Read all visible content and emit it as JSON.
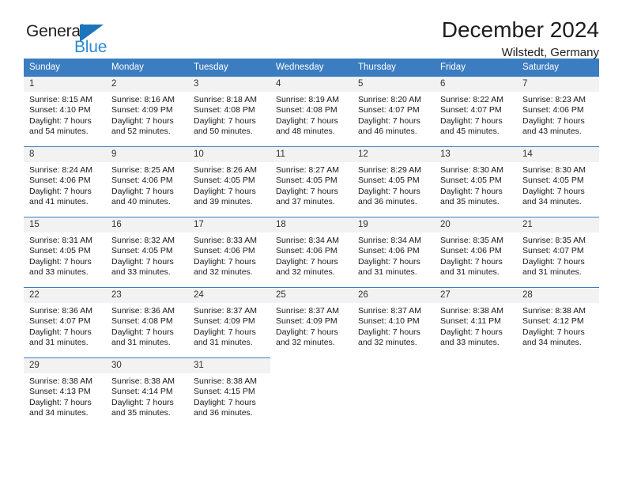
{
  "brand": {
    "name_part1": "General",
    "name_part2": "Blue",
    "triangle_icon": "triangle-icon",
    "accent_color": "#1b75bb",
    "secondary_color": "#2e8bd0"
  },
  "header": {
    "title": "December 2024",
    "subtitle": "Wilstedt, Germany"
  },
  "theme": {
    "header_row_bg": "#3b7dc0",
    "daynum_bg": "#f2f2f2",
    "text_color": "#1a1a1a",
    "row_divider": "#3b7dc0"
  },
  "weekday_headers": [
    "Sunday",
    "Monday",
    "Tuesday",
    "Wednesday",
    "Thursday",
    "Friday",
    "Saturday"
  ],
  "labels": {
    "sunrise_prefix": "Sunrise:",
    "sunset_prefix": "Sunset:",
    "daylight_prefix": "Daylight:"
  },
  "weeks": [
    [
      {
        "day": "1",
        "sunrise": "Sunrise: 8:15 AM",
        "sunset": "Sunset: 4:10 PM",
        "daylight_line1": "Daylight: 7 hours",
        "daylight_line2": "and 54 minutes."
      },
      {
        "day": "2",
        "sunrise": "Sunrise: 8:16 AM",
        "sunset": "Sunset: 4:09 PM",
        "daylight_line1": "Daylight: 7 hours",
        "daylight_line2": "and 52 minutes."
      },
      {
        "day": "3",
        "sunrise": "Sunrise: 8:18 AM",
        "sunset": "Sunset: 4:08 PM",
        "daylight_line1": "Daylight: 7 hours",
        "daylight_line2": "and 50 minutes."
      },
      {
        "day": "4",
        "sunrise": "Sunrise: 8:19 AM",
        "sunset": "Sunset: 4:08 PM",
        "daylight_line1": "Daylight: 7 hours",
        "daylight_line2": "and 48 minutes."
      },
      {
        "day": "5",
        "sunrise": "Sunrise: 8:20 AM",
        "sunset": "Sunset: 4:07 PM",
        "daylight_line1": "Daylight: 7 hours",
        "daylight_line2": "and 46 minutes."
      },
      {
        "day": "6",
        "sunrise": "Sunrise: 8:22 AM",
        "sunset": "Sunset: 4:07 PM",
        "daylight_line1": "Daylight: 7 hours",
        "daylight_line2": "and 45 minutes."
      },
      {
        "day": "7",
        "sunrise": "Sunrise: 8:23 AM",
        "sunset": "Sunset: 4:06 PM",
        "daylight_line1": "Daylight: 7 hours",
        "daylight_line2": "and 43 minutes."
      }
    ],
    [
      {
        "day": "8",
        "sunrise": "Sunrise: 8:24 AM",
        "sunset": "Sunset: 4:06 PM",
        "daylight_line1": "Daylight: 7 hours",
        "daylight_line2": "and 41 minutes."
      },
      {
        "day": "9",
        "sunrise": "Sunrise: 8:25 AM",
        "sunset": "Sunset: 4:06 PM",
        "daylight_line1": "Daylight: 7 hours",
        "daylight_line2": "and 40 minutes."
      },
      {
        "day": "10",
        "sunrise": "Sunrise: 8:26 AM",
        "sunset": "Sunset: 4:05 PM",
        "daylight_line1": "Daylight: 7 hours",
        "daylight_line2": "and 39 minutes."
      },
      {
        "day": "11",
        "sunrise": "Sunrise: 8:27 AM",
        "sunset": "Sunset: 4:05 PM",
        "daylight_line1": "Daylight: 7 hours",
        "daylight_line2": "and 37 minutes."
      },
      {
        "day": "12",
        "sunrise": "Sunrise: 8:29 AM",
        "sunset": "Sunset: 4:05 PM",
        "daylight_line1": "Daylight: 7 hours",
        "daylight_line2": "and 36 minutes."
      },
      {
        "day": "13",
        "sunrise": "Sunrise: 8:30 AM",
        "sunset": "Sunset: 4:05 PM",
        "daylight_line1": "Daylight: 7 hours",
        "daylight_line2": "and 35 minutes."
      },
      {
        "day": "14",
        "sunrise": "Sunrise: 8:30 AM",
        "sunset": "Sunset: 4:05 PM",
        "daylight_line1": "Daylight: 7 hours",
        "daylight_line2": "and 34 minutes."
      }
    ],
    [
      {
        "day": "15",
        "sunrise": "Sunrise: 8:31 AM",
        "sunset": "Sunset: 4:05 PM",
        "daylight_line1": "Daylight: 7 hours",
        "daylight_line2": "and 33 minutes."
      },
      {
        "day": "16",
        "sunrise": "Sunrise: 8:32 AM",
        "sunset": "Sunset: 4:05 PM",
        "daylight_line1": "Daylight: 7 hours",
        "daylight_line2": "and 33 minutes."
      },
      {
        "day": "17",
        "sunrise": "Sunrise: 8:33 AM",
        "sunset": "Sunset: 4:06 PM",
        "daylight_line1": "Daylight: 7 hours",
        "daylight_line2": "and 32 minutes."
      },
      {
        "day": "18",
        "sunrise": "Sunrise: 8:34 AM",
        "sunset": "Sunset: 4:06 PM",
        "daylight_line1": "Daylight: 7 hours",
        "daylight_line2": "and 32 minutes."
      },
      {
        "day": "19",
        "sunrise": "Sunrise: 8:34 AM",
        "sunset": "Sunset: 4:06 PM",
        "daylight_line1": "Daylight: 7 hours",
        "daylight_line2": "and 31 minutes."
      },
      {
        "day": "20",
        "sunrise": "Sunrise: 8:35 AM",
        "sunset": "Sunset: 4:06 PM",
        "daylight_line1": "Daylight: 7 hours",
        "daylight_line2": "and 31 minutes."
      },
      {
        "day": "21",
        "sunrise": "Sunrise: 8:35 AM",
        "sunset": "Sunset: 4:07 PM",
        "daylight_line1": "Daylight: 7 hours",
        "daylight_line2": "and 31 minutes."
      }
    ],
    [
      {
        "day": "22",
        "sunrise": "Sunrise: 8:36 AM",
        "sunset": "Sunset: 4:07 PM",
        "daylight_line1": "Daylight: 7 hours",
        "daylight_line2": "and 31 minutes."
      },
      {
        "day": "23",
        "sunrise": "Sunrise: 8:36 AM",
        "sunset": "Sunset: 4:08 PM",
        "daylight_line1": "Daylight: 7 hours",
        "daylight_line2": "and 31 minutes."
      },
      {
        "day": "24",
        "sunrise": "Sunrise: 8:37 AM",
        "sunset": "Sunset: 4:09 PM",
        "daylight_line1": "Daylight: 7 hours",
        "daylight_line2": "and 31 minutes."
      },
      {
        "day": "25",
        "sunrise": "Sunrise: 8:37 AM",
        "sunset": "Sunset: 4:09 PM",
        "daylight_line1": "Daylight: 7 hours",
        "daylight_line2": "and 32 minutes."
      },
      {
        "day": "26",
        "sunrise": "Sunrise: 8:37 AM",
        "sunset": "Sunset: 4:10 PM",
        "daylight_line1": "Daylight: 7 hours",
        "daylight_line2": "and 32 minutes."
      },
      {
        "day": "27",
        "sunrise": "Sunrise: 8:38 AM",
        "sunset": "Sunset: 4:11 PM",
        "daylight_line1": "Daylight: 7 hours",
        "daylight_line2": "and 33 minutes."
      },
      {
        "day": "28",
        "sunrise": "Sunrise: 8:38 AM",
        "sunset": "Sunset: 4:12 PM",
        "daylight_line1": "Daylight: 7 hours",
        "daylight_line2": "and 34 minutes."
      }
    ],
    [
      {
        "day": "29",
        "sunrise": "Sunrise: 8:38 AM",
        "sunset": "Sunset: 4:13 PM",
        "daylight_line1": "Daylight: 7 hours",
        "daylight_line2": "and 34 minutes."
      },
      {
        "day": "30",
        "sunrise": "Sunrise: 8:38 AM",
        "sunset": "Sunset: 4:14 PM",
        "daylight_line1": "Daylight: 7 hours",
        "daylight_line2": "and 35 minutes."
      },
      {
        "day": "31",
        "sunrise": "Sunrise: 8:38 AM",
        "sunset": "Sunset: 4:15 PM",
        "daylight_line1": "Daylight: 7 hours",
        "daylight_line2": "and 36 minutes."
      },
      {
        "day": "",
        "sunrise": "",
        "sunset": "",
        "daylight_line1": "",
        "daylight_line2": ""
      },
      {
        "day": "",
        "sunrise": "",
        "sunset": "",
        "daylight_line1": "",
        "daylight_line2": ""
      },
      {
        "day": "",
        "sunrise": "",
        "sunset": "",
        "daylight_line1": "",
        "daylight_line2": ""
      },
      {
        "day": "",
        "sunrise": "",
        "sunset": "",
        "daylight_line1": "",
        "daylight_line2": ""
      }
    ]
  ]
}
